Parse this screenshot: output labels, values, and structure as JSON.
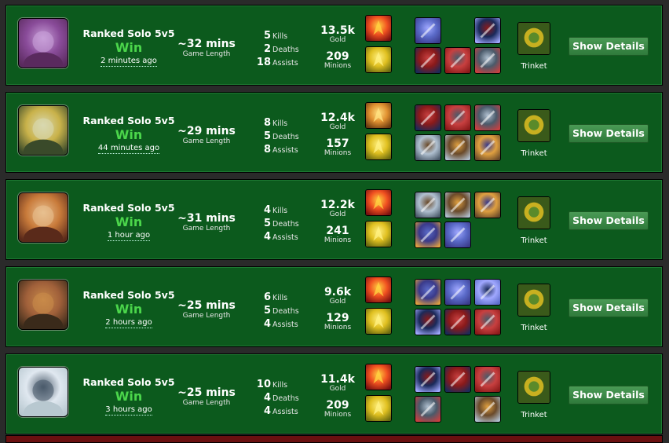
{
  "matches": [
    {
      "queue": "Ranked Solo 5v5",
      "result": "Win",
      "time_ago": "2 minutes ago",
      "length": "~32 mins",
      "length_label": "Game Length",
      "kills": "5",
      "deaths": "2",
      "assists": "18",
      "gold": "13.5k",
      "minions": "209",
      "champion_icon": "yordle-girl-portrait",
      "spells": [
        "flash-icon",
        "heal-icon"
      ],
      "items": [
        "hourglass-icon",
        "",
        "hammer-icon",
        "void-staff-icon",
        "wizard-hat-icon",
        "boots-icon"
      ]
    },
    {
      "queue": "Ranked Solo 5v5",
      "result": "Win",
      "time_ago": "44 minutes ago",
      "length": "~29 mins",
      "length_label": "Game Length",
      "kills": "8",
      "deaths": "5",
      "assists": "8",
      "gold": "12.4k",
      "minions": "157",
      "champion_icon": "gunner-portrait",
      "spells": [
        "barrier-icon",
        "heal-icon"
      ],
      "items": [
        "sword-icon",
        "gauntlet-icon",
        "wave-icon",
        "greaves-icon",
        "cloak-icon",
        "mantle-icon"
      ]
    },
    {
      "queue": "Ranked Solo 5v5",
      "result": "Win",
      "time_ago": "1 hour ago",
      "length": "~31 mins",
      "length_label": "Game Length",
      "kills": "4",
      "deaths": "5",
      "assists": "4",
      "gold": "12.2k",
      "minions": "241",
      "champion_icon": "scout-portrait",
      "spells": [
        "flash-icon",
        "heal-icon"
      ],
      "items": [
        "sword-icon",
        "armor-icon",
        "claw-icon",
        "helm-icon",
        "dagger-icon",
        ""
      ]
    },
    {
      "queue": "Ranked Solo 5v5",
      "result": "Win",
      "time_ago": "2 hours ago",
      "length": "~25 mins",
      "length_label": "Game Length",
      "kills": "6",
      "deaths": "5",
      "assists": "4",
      "gold": "9.6k",
      "minions": "129",
      "champion_icon": "cowboy-portrait",
      "spells": [
        "flash-icon",
        "heal-icon"
      ],
      "items": [
        "eye-icon",
        "blade-icon",
        "scroll-icon",
        "longsword-icon",
        "horn-icon",
        "boots-icon"
      ]
    },
    {
      "queue": "Ranked Solo 5v5",
      "result": "Win",
      "time_ago": "3 hours ago",
      "length": "~25 mins",
      "length_label": "Game Length",
      "kills": "10",
      "deaths": "4",
      "assists": "4",
      "gold": "11.4k",
      "minions": "209",
      "champion_icon": "swordswoman-portrait",
      "spells": [
        "flash-icon",
        "heal-icon"
      ],
      "items": [
        "gauntlet-icon",
        "greatsword-icon",
        "scroll-icon",
        "berserker-boots-icon",
        "",
        "shield-icon"
      ]
    }
  ],
  "labels": {
    "kills": "Kills",
    "deaths": "Deaths",
    "assists": "Assists",
    "gold": "Gold",
    "minions": "Minions",
    "trinket": "Trinket",
    "button": "Show Details"
  },
  "colors": {
    "row_bg": "#0c5a1d",
    "win": "#4bd64b",
    "page_bg": "#2a2a2a"
  }
}
